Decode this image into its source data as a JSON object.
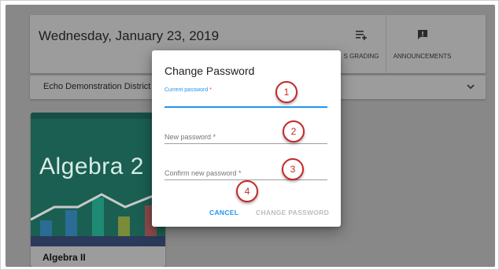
{
  "header": {
    "date_title": "Wednesday, January 23, 2019",
    "grading_label": "S GRADING",
    "announcements_label": "ANNOUNCEMENTS"
  },
  "district": {
    "label": "Echo Demonstration District"
  },
  "course_card": {
    "art_title": "Algebra 2",
    "name": "Algebra II"
  },
  "dialog": {
    "title": "Change Password",
    "fields": [
      {
        "label": "Current password",
        "required_mark": "*",
        "value": ""
      },
      {
        "label": "New password *",
        "value": ""
      },
      {
        "label": "Confirm new password *",
        "value": ""
      }
    ],
    "cancel_label": "CANCEL",
    "change_label": "CHANGE PASSWORD"
  },
  "callouts": [
    "1",
    "2",
    "3",
    "4"
  ],
  "colors": {
    "accent": "#2196f3",
    "required": "#e53935",
    "callout_red": "#c62828",
    "course_teal": "#1a7a66"
  }
}
